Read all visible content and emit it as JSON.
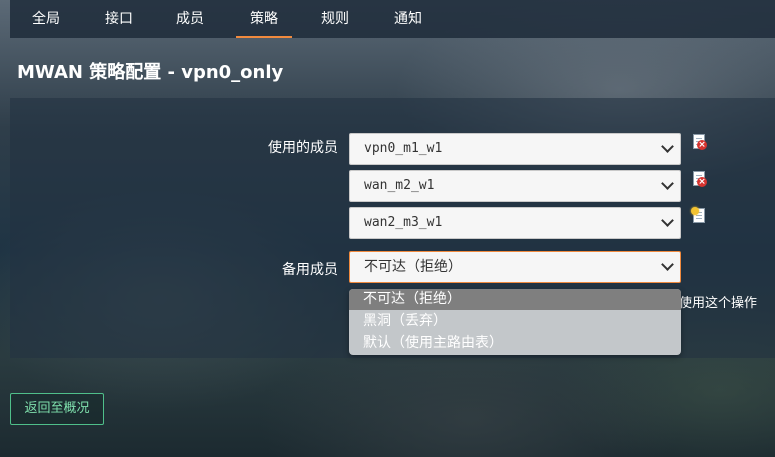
{
  "nav": {
    "tabs": [
      {
        "label": "全局"
      },
      {
        "label": "接口"
      },
      {
        "label": "成员"
      },
      {
        "label": "策略"
      },
      {
        "label": "规则"
      },
      {
        "label": "通知"
      }
    ],
    "active_tab": "策略"
  },
  "page": {
    "title": "MWAN 策略配置 - vpn0_only"
  },
  "form": {
    "members_label": "使用的成员",
    "members": [
      {
        "value": "vpn0_m1_w1",
        "action_icon": "delete-icon"
      },
      {
        "value": "wan_m2_w1",
        "action_icon": "delete-icon"
      },
      {
        "value": "wan2_m3_w1",
        "action_icon": "add-icon"
      }
    ],
    "fallback_label": "备用成员",
    "fallback_value": "不可达（拒绝）",
    "fallback_options": [
      "不可达（拒绝）",
      "黑洞（丢弃）",
      "默认（使用主路由表）"
    ],
    "hint_tail": "使用这个操作"
  },
  "footer": {
    "back_label": "返回至概况"
  },
  "colors": {
    "accent": "#f08a3e",
    "back_button": "#4fbf8a"
  }
}
